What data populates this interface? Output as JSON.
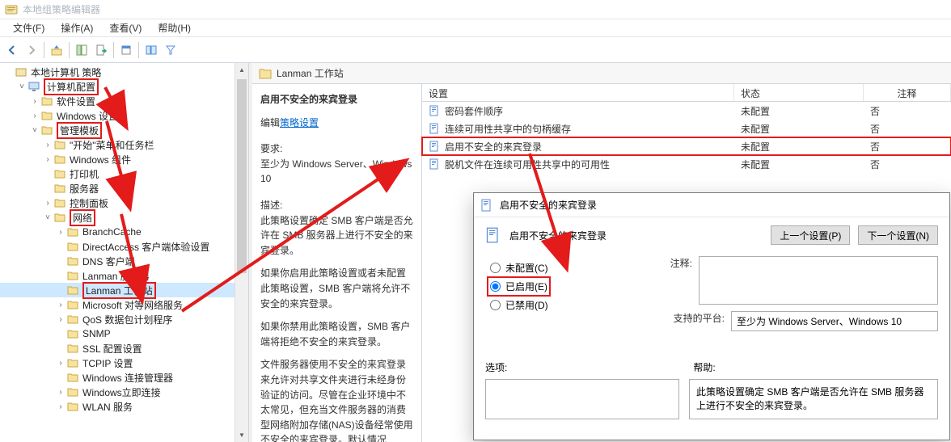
{
  "app": {
    "title": "本地组策略编辑器"
  },
  "menu": {
    "file": "文件(F)",
    "action": "操作(A)",
    "view": "查看(V)",
    "help": "帮助(H)"
  },
  "tree": {
    "root": "本地计算机 策略",
    "computer_config": "计算机配置",
    "software_settings": "软件设置",
    "windows_settings": "Windows 设置",
    "admin_templates": "管理模板",
    "start_menu": "\"开始\"菜单和任务栏",
    "windows_components": "Windows 组件",
    "printers": "打印机",
    "servers": "服务器",
    "control_panel": "控制面板",
    "network": "网络",
    "branchcache": "BranchCache",
    "directaccess": "DirectAccess 客户端体验设置",
    "dns_client": "DNS 客户端",
    "lanman_server": "Lanman 服务器",
    "lanman_workstation": "Lanman 工作站",
    "ms_p2p": "Microsoft 对等网络服务",
    "qos": "QoS 数据包计划程序",
    "snmp": "SNMP",
    "ssl": "SSL 配置设置",
    "tcpip": "TCPIP 设置",
    "win_conn_mgr": "Windows 连接管理器",
    "win_instant_conn": "Windows立即连接",
    "wlan": "WLAN 服务"
  },
  "content": {
    "crumb": "Lanman 工作站",
    "col_setting": "设置",
    "col_state": "状态",
    "col_note": "注释",
    "desc_title": "启用不安全的来宾登录",
    "desc_edit_prefix": "编辑",
    "desc_edit_link": "策略设置",
    "desc_req_label": "要求:",
    "desc_req_text": "至少为 Windows Server、Windows 10",
    "desc_desc_label": "描述:",
    "desc_p1": "此策略设置确定 SMB 客户端是否允许在 SMB 服务器上进行不安全的来宾登录。",
    "desc_p2": "如果你启用此策略设置或者未配置此策略设置，SMB 客户端将允许不安全的来宾登录。",
    "desc_p3": "如果你禁用此策略设置，SMB 客户端将拒绝不安全的来宾登录。",
    "desc_p4": "文件服务器使用不安全的来宾登录来允许对共享文件夹进行未经身份验证的访问。尽管在企业环境中不太常见，但充当文件服务器的消费型网络附加存储(NAS)设备经常使用不安全的来宾登录。默认情况",
    "rows": [
      {
        "name": "密码套件顺序",
        "state": "未配置",
        "note": "否"
      },
      {
        "name": "连续可用性共享中的句柄缓存",
        "state": "未配置",
        "note": "否"
      },
      {
        "name": "启用不安全的来宾登录",
        "state": "未配置",
        "note": "否",
        "hl": true
      },
      {
        "name": "脱机文件在连续可用性共享中的可用性",
        "state": "未配置",
        "note": "否"
      }
    ]
  },
  "dialog": {
    "title": "启用不安全的来宾登录",
    "name": "启用不安全的来宾登录",
    "prev": "上一个设置(P)",
    "next": "下一个设置(N)",
    "r_notconf": "未配置(C)",
    "r_enabled": "已启用(E)",
    "r_disabled": "已禁用(D)",
    "note_label": "注释:",
    "platform_label": "支持的平台:",
    "platform_text": "至少为 Windows Server、Windows 10",
    "options_label": "选项:",
    "help_label": "帮助:",
    "help_text": "此策略设置确定 SMB 客户端是否允许在 SMB 服务器上进行不安全的来宾登录。"
  }
}
